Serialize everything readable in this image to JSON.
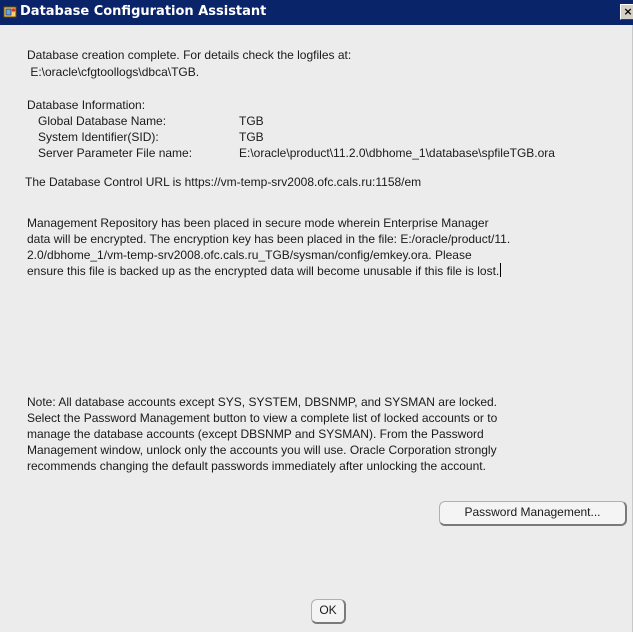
{
  "window": {
    "title": "Database Configuration Assistant",
    "close_glyph": "×"
  },
  "summary": {
    "line1": "Database creation complete. For details check the logfiles at:",
    "line2": " E:\\oracle\\cfgtoollogs\\dbca\\TGB."
  },
  "db_info": {
    "heading": "Database Information:",
    "rows": [
      {
        "label": "Global Database Name:",
        "value": "TGB"
      },
      {
        "label": "System Identifier(SID):",
        "value": "TGB"
      },
      {
        "label": "Server Parameter File name:",
        "value": "E:\\oracle\\product\\11.2.0\\dbhome_1\\database\\spfileTGB.ora"
      }
    ]
  },
  "url_text": "The Database Control URL is https://vm-temp-srv2008.ofc.cals.ru:1158/em",
  "repository_text": [
    "Management Repository has been placed in secure mode wherein Enterprise Manager",
    "data will be encrypted.  The encryption key has been placed in the file: E:/oracle/product/11.",
    "2.0/dbhome_1/vm-temp-srv2008.ofc.cals.ru_TGB/sysman/config/emkey.ora.   Please",
    "ensure this file is backed up as the encrypted data will become unusable if this file is lost."
  ],
  "note_text": [
    "Note: All database accounts except SYS, SYSTEM, DBSNMP, and SYSMAN are locked.",
    "Select the Password Management button to view a complete list of locked accounts or to",
    "manage the database accounts (except DBSNMP and SYSMAN). From the Password",
    "Management window, unlock only the accounts you will use. Oracle Corporation strongly",
    "recommends changing the default passwords immediately after unlocking the account."
  ],
  "buttons": {
    "password_management": "Password Management...",
    "ok": "OK"
  }
}
